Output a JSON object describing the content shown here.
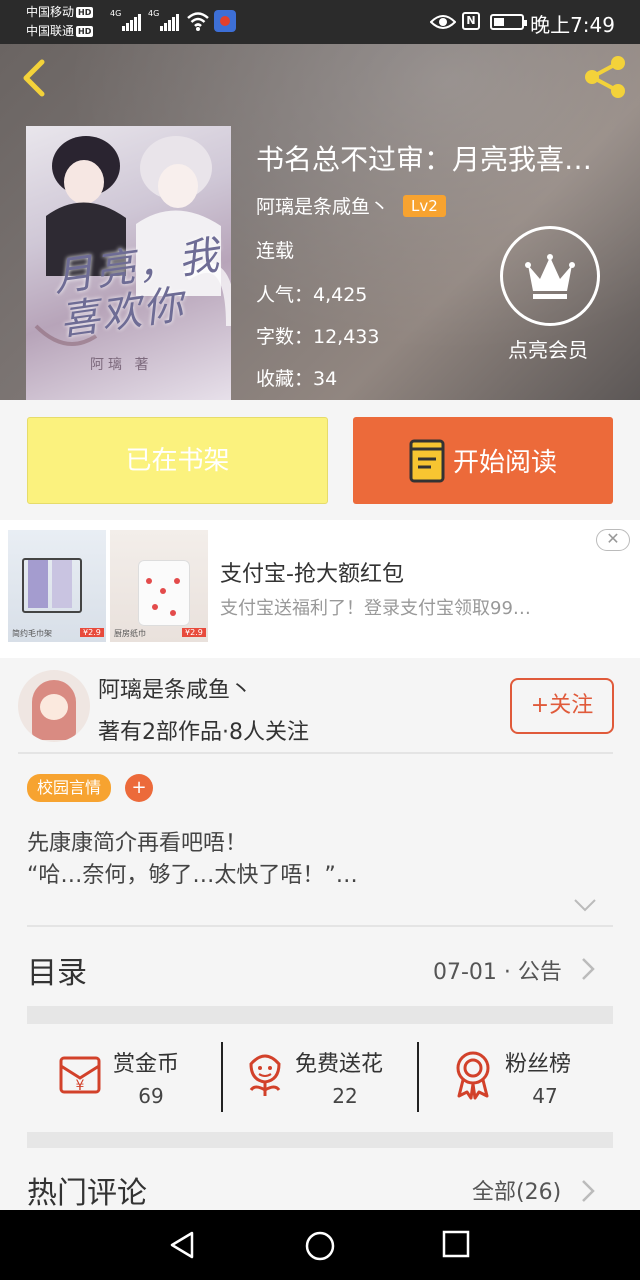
{
  "status_bar": {
    "carrier1": "中国移动",
    "carrier2": "中国联通",
    "hd": "HD",
    "net1": "4G",
    "net2": "4G",
    "nfc": "N",
    "time": "晚上7:49"
  },
  "book": {
    "title": "书名总不过审：月亮我喜…",
    "author": "阿璃是条咸鱼丶",
    "level": "Lv2",
    "status": "连载",
    "popularity": "人气：4,425",
    "word_count": "字数：12,433",
    "collections": "收藏：34",
    "cover_title": "月亮，我喜欢你",
    "cover_author": "阿璃 著",
    "vip_label": "点亮会员"
  },
  "actions": {
    "shelf_label": "已在书架",
    "read_label": "开始阅读"
  },
  "ad": {
    "title": "支付宝-抢大额红包",
    "subtitle": "支付宝送福利了！登录支付宝领取99…",
    "close": "✕",
    "price1": "¥2.9",
    "price2": "¥2.9",
    "caption1": "简约毛巾架",
    "caption2": "厨房纸巾"
  },
  "author_card": {
    "name": "阿璃是条咸鱼丶",
    "stats": "著有2部作品·8人关注",
    "follow_label": "+关注"
  },
  "tags": {
    "genre": "校园言情",
    "add": "+"
  },
  "intro": {
    "line1": "先康康简介再看吧唔！",
    "line2": "“哈…奈何，够了…太快了唔！”…"
  },
  "toc": {
    "label": "目录",
    "update": "07-01 · 公告"
  },
  "stats": {
    "reward_label": "赏金币",
    "reward_value": "69",
    "flower_label": "免费送花",
    "flower_value": "22",
    "fans_label": "粉丝榜",
    "fans_value": "47"
  },
  "comments": {
    "label": "热门评论",
    "all_label": "全部(26)"
  },
  "colors": {
    "accent_orange": "#ec6a3a",
    "level_orange": "#f7a330",
    "shelf_yellow": "#fbf27e",
    "follow_red": "#e05a3a"
  },
  "icons": [
    "back-arrow-icon",
    "share-icon",
    "crown-icon",
    "book-icon",
    "red-envelope-icon",
    "flower-icon",
    "medal-icon",
    "chevron-down-icon",
    "chevron-right-icon",
    "nav-back-icon",
    "nav-home-icon",
    "nav-recent-icon"
  ]
}
